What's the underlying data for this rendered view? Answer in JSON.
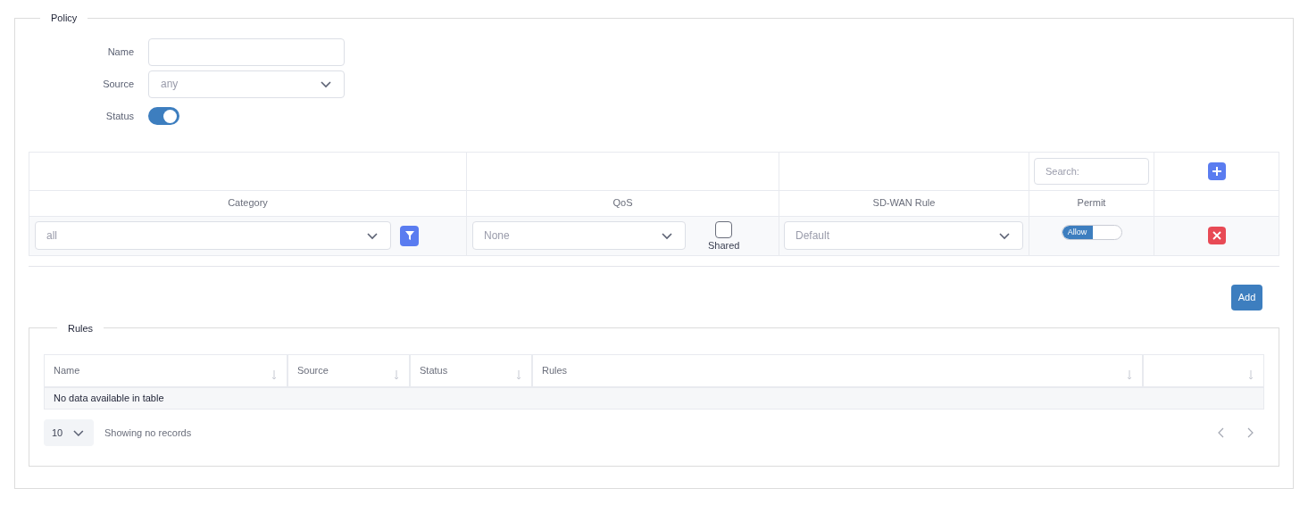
{
  "policy": {
    "legend": "Policy",
    "fields": [
      {
        "kind": "text",
        "label": "Name"
      },
      {
        "kind": "select",
        "label": "Source",
        "value": "any"
      },
      {
        "kind": "toggle",
        "label": "Status",
        "on": true
      }
    ]
  },
  "rule_editor": {
    "search": {
      "placeholder": "Search:"
    },
    "columns": [
      "Category",
      "QoS",
      "SD-WAN Rule",
      "Permit"
    ],
    "row": {
      "category": "all",
      "qos": "None",
      "shared": {
        "label": "Shared",
        "checked": false
      },
      "sdwan": "Default",
      "permit": {
        "label": "Allow",
        "on": true
      }
    }
  },
  "add_button": "Add",
  "rules": {
    "legend": "Rules",
    "columns": [
      {
        "label": "Name"
      },
      {
        "label": "Source"
      },
      {
        "label": "Status"
      },
      {
        "label": "Rules"
      },
      {}
    ],
    "empty": "No data available in table",
    "page_size": "10",
    "info": "Showing no records"
  }
}
